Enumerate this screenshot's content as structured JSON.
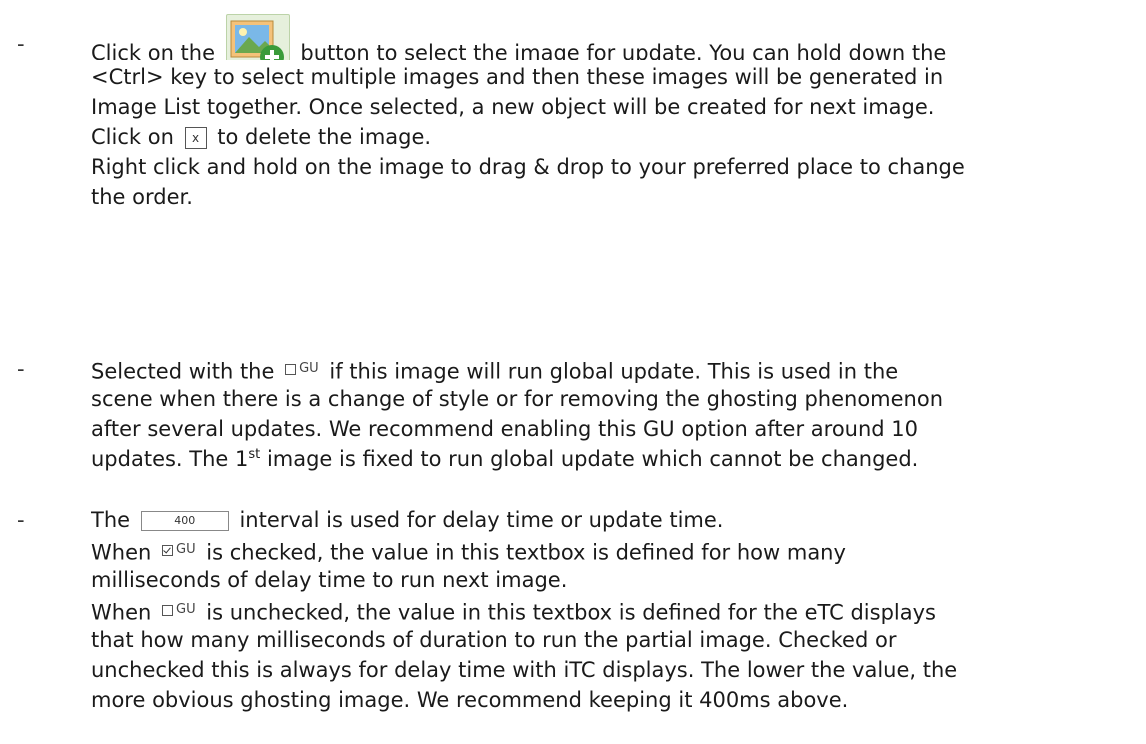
{
  "dash": "-",
  "item1": {
    "l1_pre": "Click on the",
    "icon": "image-add-icon",
    "l1_post": "button to select the image for update. You can hold down the",
    "l2": "<Ctrl> key to select multiple images and then these images will be generated in",
    "l3": "Image List together. Once selected, a new object will be created for next image.",
    "l4_pre": "Click on",
    "x_label": "x",
    "l4_post": "to delete the image.",
    "l5": "Right click and hold on the image to drag & drop to your preferred place to change",
    "l6": "the order."
  },
  "item2": {
    "l1_pre": "Selected with the",
    "gu_label": "GU",
    "l1_post": "if this image will run global update. This is used in the",
    "l2": "scene when there is a change of style or for removing the ghosting phenomenon",
    "l3": "after several updates. We recommend enabling this GU option after around 10",
    "l4_pre": "updates. The 1",
    "l4_sup": "st",
    "l4_post": " image is fixed to run global update which cannot be changed."
  },
  "item3": {
    "l1_pre": "The",
    "interval_value": "400",
    "l1_post": "interval is used for delay time or update time.",
    "l2_pre": "When",
    "gu_label": "GU",
    "l2_post": "is checked, the value in this textbox is defined for how many",
    "l3": "milliseconds of delay time to run next image.",
    "l4_pre": "When",
    "l4_post": "is unchecked, the value in this textbox is defined for the eTC displays",
    "l5": "that how many milliseconds of duration to run the partial image. Checked or",
    "l6": "unchecked this is always for delay time with iTC displays. The lower the value, the",
    "l7": "more obvious ghosting image. We recommend keeping it 400ms above."
  }
}
